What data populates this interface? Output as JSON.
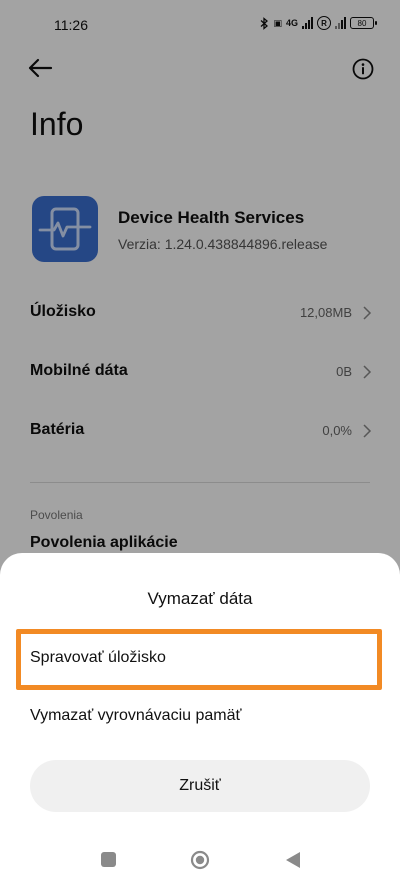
{
  "status_bar": {
    "time": "11:26",
    "network_label": "4G",
    "battery": "80",
    "icons": [
      "bluetooth-icon",
      "volte-icon",
      "signal-icon",
      "roaming-icon",
      "signal-icon",
      "battery-icon"
    ]
  },
  "header": {
    "title": "Info",
    "back_icon": "arrow-left-icon",
    "info_icon": "info-circle-icon"
  },
  "app": {
    "name": "Device Health Services",
    "version": "Verzia: 1.24.0.438844896.release",
    "icon": "device-health-icon",
    "icon_color": "#3b6fd1"
  },
  "rows": [
    {
      "label": "Úložisko",
      "value": "12,08MB"
    },
    {
      "label": "Mobilné dáta",
      "value": "0B"
    },
    {
      "label": "Batéria",
      "value": "0,0%"
    }
  ],
  "permissions": {
    "section_label": "Povolenia",
    "item_label": "Povolenia aplikácie"
  },
  "sheet": {
    "title": "Vymazať dáta",
    "options": [
      "Spravovať úložisko",
      "Vymazať vyrovnávaciu pamäť"
    ],
    "cancel_label": "Zrušiť",
    "highlight_color": "#f28a24"
  },
  "nav_bar": {
    "icons": [
      "recents-square-icon",
      "home-circle-icon",
      "back-triangle-icon"
    ]
  }
}
